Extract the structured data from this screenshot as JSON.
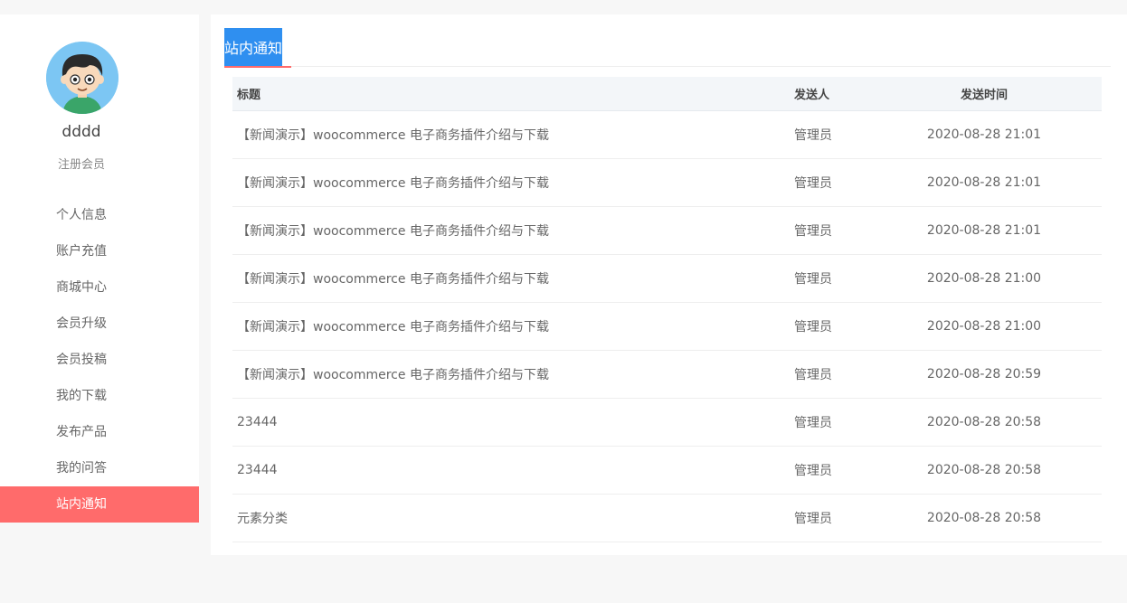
{
  "user": {
    "name": "dddd",
    "role": "注册会员"
  },
  "sidebar": {
    "items": [
      {
        "label": "个人信息"
      },
      {
        "label": "账户充值"
      },
      {
        "label": "商城中心"
      },
      {
        "label": "会员升级"
      },
      {
        "label": "会员投稿"
      },
      {
        "label": "我的下载"
      },
      {
        "label": "发布产品"
      },
      {
        "label": "我的问答"
      },
      {
        "label": "站内通知"
      }
    ],
    "active_index": 8
  },
  "main": {
    "tab_label": "站内通知",
    "table": {
      "headers": {
        "title": "标题",
        "sender": "发送人",
        "time": "发送时间"
      },
      "rows": [
        {
          "title": "【新闻演示】woocommerce 电子商务插件介绍与下载",
          "sender": "管理员",
          "time": "2020-08-28 21:01"
        },
        {
          "title": "【新闻演示】woocommerce 电子商务插件介绍与下载",
          "sender": "管理员",
          "time": "2020-08-28 21:01"
        },
        {
          "title": "【新闻演示】woocommerce 电子商务插件介绍与下载",
          "sender": "管理员",
          "time": "2020-08-28 21:01"
        },
        {
          "title": "【新闻演示】woocommerce 电子商务插件介绍与下载",
          "sender": "管理员",
          "time": "2020-08-28 21:00"
        },
        {
          "title": "【新闻演示】woocommerce 电子商务插件介绍与下载",
          "sender": "管理员",
          "time": "2020-08-28 21:00"
        },
        {
          "title": "【新闻演示】woocommerce 电子商务插件介绍与下载",
          "sender": "管理员",
          "time": "2020-08-28 20:59"
        },
        {
          "title": "23444",
          "sender": "管理员",
          "time": "2020-08-28 20:58"
        },
        {
          "title": "23444",
          "sender": "管理员",
          "time": "2020-08-28 20:58"
        },
        {
          "title": "元素分类",
          "sender": "管理员",
          "time": "2020-08-28 20:58"
        }
      ]
    }
  },
  "colors": {
    "accent": "#ff6b6b",
    "tab_highlight": "#2f8ff0",
    "page_bg": "#f7f7f7"
  }
}
